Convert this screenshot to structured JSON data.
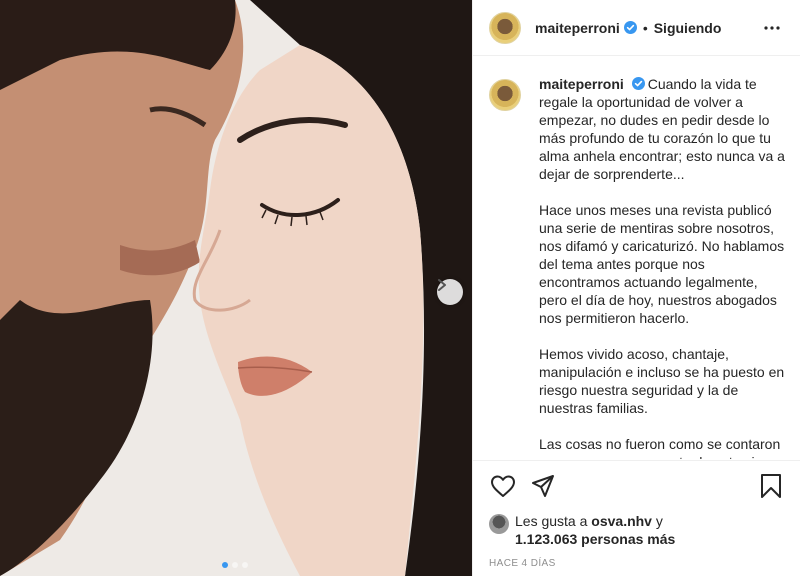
{
  "post": {
    "username": "maiteperroni",
    "follow_label": "Siguiendo",
    "separator": "•",
    "caption_paragraphs": [
      "Cuando la vida te regale la oportunidad de volver a empezar, no dudes en pedir desde lo más profundo de tu corazón lo que tu alma anhela encontrar; esto nunca va a dejar de sorprenderte...",
      "Hace unos meses una revista publicó una serie de mentiras sobre nosotros, nos difamó y caricaturizó. No hablamos del tema antes porque nos encontramos actuando legalmente, pero el día de hoy, nuestros abogados nos permitieron hacerlo.",
      "Hemos vivido acoso, chantaje, manipulación e incluso se ha puesto en riesgo nuestra seguridad y la de nuestras familias.",
      "Las cosas no fueron como se contaron y no queremos ser parte de este circo"
    ],
    "likes_prefix": "Les gusta a",
    "liked_by_user": "osva.nhv",
    "likes_conjunction": "y",
    "likes_count": "1.123.063 personas más",
    "timestamp": "HACE 4 DÍAS"
  },
  "carousel": {
    "total_slides": 3,
    "active_slide": 1
  },
  "icons": {
    "verified": "verified-badge-icon",
    "more": "more-options-icon",
    "like": "heart-icon",
    "share": "paper-plane-icon",
    "save": "bookmark-icon",
    "next": "chevron-right-icon"
  },
  "colors": {
    "verified": "#3897f0",
    "text": "#262626",
    "muted": "#8e8e8e"
  }
}
